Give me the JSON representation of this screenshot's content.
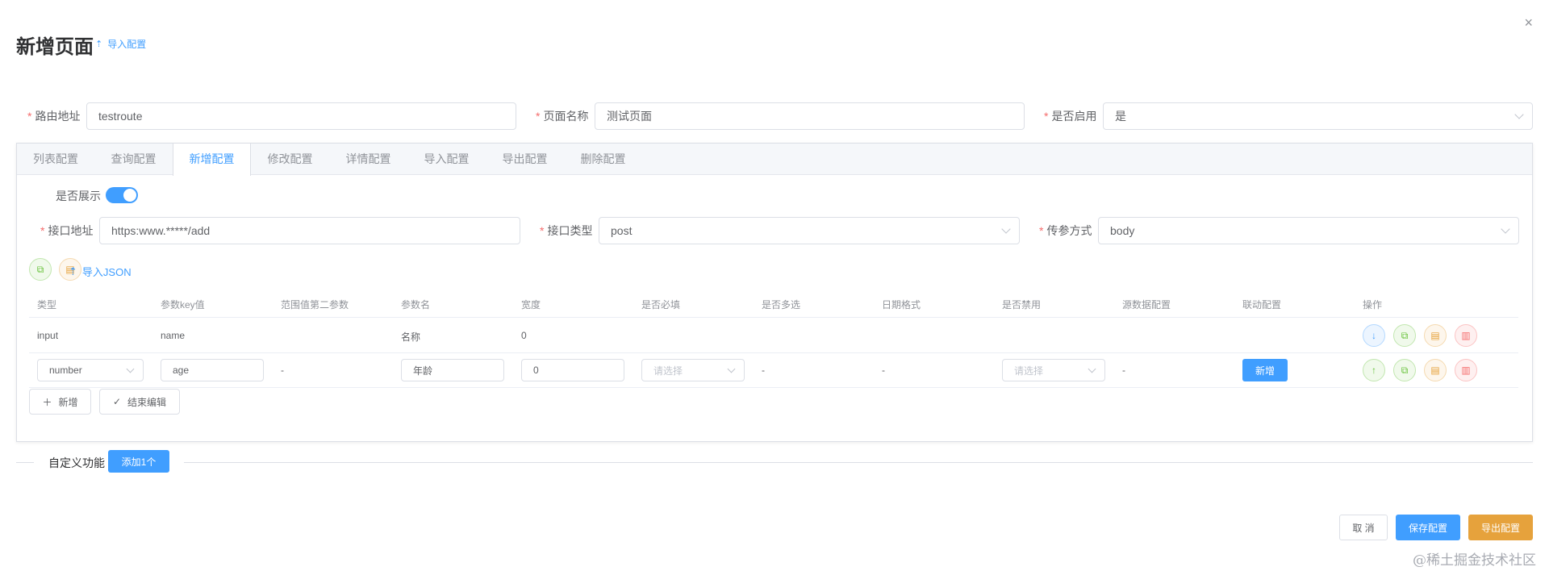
{
  "dialog": {
    "title": "新增页面",
    "import_config_label": "导入配置",
    "close_symbol": "×"
  },
  "form": {
    "route": {
      "label": "路由地址",
      "value": "testroute"
    },
    "page_name": {
      "label": "页面名称",
      "value": "测试页面"
    },
    "enabled": {
      "label": "是否启用",
      "value": "是"
    }
  },
  "tabs": [
    {
      "label": "列表配置"
    },
    {
      "label": "查询配置"
    },
    {
      "label": "新增配置",
      "active": true
    },
    {
      "label": "修改配置"
    },
    {
      "label": "详情配置"
    },
    {
      "label": "导入配置"
    },
    {
      "label": "导出配置"
    },
    {
      "label": "删除配置"
    }
  ],
  "add_config": {
    "show_label": "是否展示",
    "show_enabled": true,
    "api_url": {
      "label": "接口地址",
      "value": "https:www.*****/add"
    },
    "api_type": {
      "label": "接口类型",
      "value": "post"
    },
    "param_mode": {
      "label": "传参方式",
      "value": "body"
    },
    "import_json_label": "导入JSON"
  },
  "table": {
    "headers": [
      "类型",
      "参数key值",
      "范围值第二参数",
      "参数名",
      "宽度",
      "是否必填",
      "是否多选",
      "日期格式",
      "是否禁用",
      "源数据配置",
      "联动配置",
      "操作"
    ],
    "rows": [
      {
        "type": "input",
        "key": "name",
        "range2": "",
        "name": "名称",
        "width": "0"
      },
      {
        "type": "number",
        "key": "age",
        "range2": "-",
        "name": "年龄",
        "width": "0",
        "required_placeholder": "请选择",
        "multi": "-",
        "date_format": "-",
        "disabled_placeholder": "请选择",
        "source": "-",
        "link_btn": "新增"
      }
    ],
    "add_row_label": "新增",
    "finish_edit_label": "结束编辑"
  },
  "custom": {
    "label": "自定义功能",
    "add_one_label": "添加1个"
  },
  "footer": {
    "cancel_label": "取 消",
    "save_label": "保存配置",
    "export_label": "导出配置"
  },
  "watermark": "@稀土掘金技术社区",
  "colors": {
    "primary": "#409eff",
    "warning": "#e6a23c",
    "success": "#67c23a",
    "danger": "#f56c6c"
  },
  "icons": {
    "close": "close-icon",
    "upload": "upload-icon",
    "copy": "copy-icon",
    "document": "document-icon",
    "arrow_down": "arrow-down-icon",
    "arrow_up": "arrow-up-icon",
    "delete": "delete-icon",
    "plus": "plus-icon",
    "check": "check-icon"
  }
}
